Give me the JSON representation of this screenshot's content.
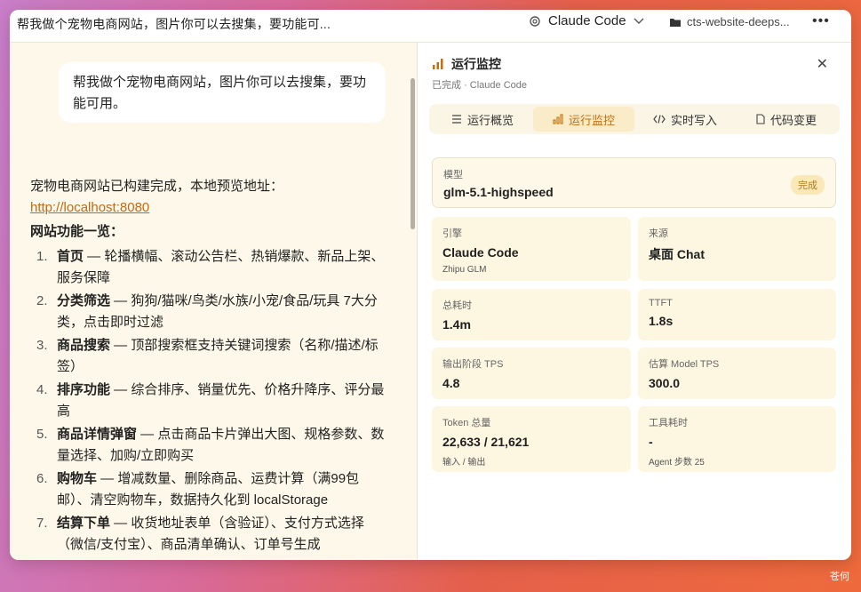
{
  "window": {
    "title": "帮我做个宠物电商网站，图片你可以去搜集，要功能可...",
    "engine": "Claude Code",
    "folder": "cts-website-deeps...",
    "more": "•••"
  },
  "chat": {
    "user_message": "帮我做个宠物电商网站，图片你可以去搜集，要功能可用。",
    "reply_intro": "宠物电商网站已构建完成，本地预览地址：",
    "reply_link": "http://localhost:8080",
    "list_heading": "网站功能一览：",
    "features": [
      {
        "num": "1.",
        "name": "首页",
        "desc": " — 轮播横幅、滚动公告栏、热销爆款、新品上架、服务保障"
      },
      {
        "num": "2.",
        "name": "分类筛选",
        "desc": " — 狗狗/猫咪/鸟类/水族/小宠/食品/玩具 7大分类，点击即时过滤"
      },
      {
        "num": "3.",
        "name": "商品搜索",
        "desc": " — 顶部搜索框支持关键词搜索（名称/描述/标签）"
      },
      {
        "num": "4.",
        "name": "排序功能",
        "desc": " — 综合排序、销量优先、价格升降序、评分最高"
      },
      {
        "num": "5.",
        "name": "商品详情弹窗",
        "desc": " — 点击商品卡片弹出大图、规格参数、数量选择、加购/立即购买"
      },
      {
        "num": "6.",
        "name": "购物车",
        "desc": " — 增减数量、删除商品、运费计算（满99包邮）、清空购物车，数据持久化到 localStorage"
      },
      {
        "num": "7.",
        "name": "结算下单",
        "desc": " — 收货地址表单（含验证）、支付方式选择（微信/支付宝）、商品清单确认、订单号生成"
      }
    ]
  },
  "panel": {
    "title": "运行监控",
    "subtitle": "已完成 · Claude Code",
    "close": "✕",
    "tabs": [
      {
        "label": "运行概览",
        "icon": "list-icon"
      },
      {
        "label": "运行监控",
        "icon": "bar-chart-icon"
      },
      {
        "label": "实时写入",
        "icon": "code-icon"
      },
      {
        "label": "代码变更",
        "icon": "file-icon"
      }
    ],
    "active_tab": 1,
    "model": {
      "label": "模型",
      "value": "glm-5.1-highspeed",
      "badge": "完成"
    },
    "metrics": [
      {
        "label": "引擎",
        "value": "Claude Code",
        "sub": "Zhipu GLM"
      },
      {
        "label": "来源",
        "value": "桌面 Chat",
        "sub": ""
      },
      {
        "label": "总耗时",
        "value": "1.4m",
        "sub": ""
      },
      {
        "label": "TTFT",
        "value": "1.8s",
        "sub": ""
      },
      {
        "label": "输出阶段 TPS",
        "value": "4.8",
        "sub": ""
      },
      {
        "label": "估算 Model TPS",
        "value": "300.0",
        "sub": ""
      },
      {
        "label": "Token 总量",
        "value": "22,633 / 21,621",
        "sub": "输入 / 输出"
      },
      {
        "label": "工具耗时",
        "value": "-",
        "sub": "Agent 步数 25"
      }
    ]
  },
  "watermark": "苍何",
  "colors": {
    "accent": "#c2700e",
    "link": "#c26a12",
    "panel_bg": "#fdf6e1"
  }
}
